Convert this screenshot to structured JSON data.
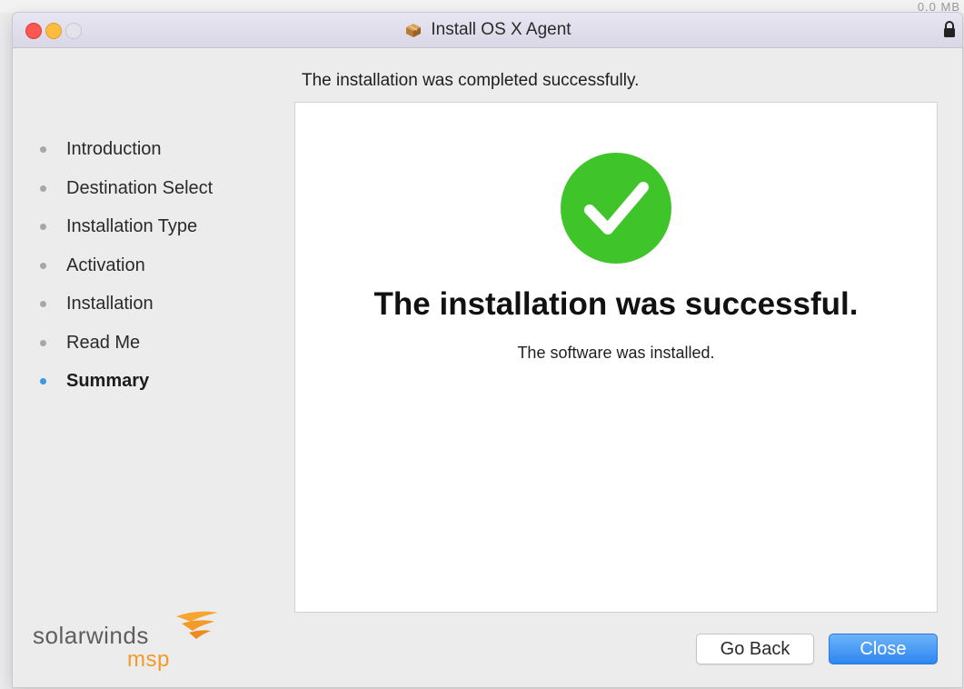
{
  "window": {
    "title": "Install OS X Agent",
    "title_icon": "package-icon",
    "lock_icon": "lock-icon"
  },
  "background_peek": "0.0 MB",
  "sidebar": {
    "steps": [
      {
        "label": "Introduction",
        "active": false
      },
      {
        "label": "Destination Select",
        "active": false
      },
      {
        "label": "Installation Type",
        "active": false
      },
      {
        "label": "Activation",
        "active": false
      },
      {
        "label": "Installation",
        "active": false
      },
      {
        "label": "Read Me",
        "active": false
      },
      {
        "label": "Summary",
        "active": true
      }
    ]
  },
  "main": {
    "heading": "The installation was completed successfully.",
    "success_title": "The installation was successful.",
    "success_subtitle": "The software was installed.",
    "status_icon": "success-check-icon"
  },
  "logo": {
    "main": "solarwinds",
    "sub": "msp"
  },
  "buttons": {
    "back_label": "Go Back",
    "close_label": "Close"
  },
  "colors": {
    "success_green": "#3fc52a",
    "active_step_dot": "#3b97ec",
    "primary_button": "#2f86f0",
    "brand_orange": "#f39a2b"
  }
}
